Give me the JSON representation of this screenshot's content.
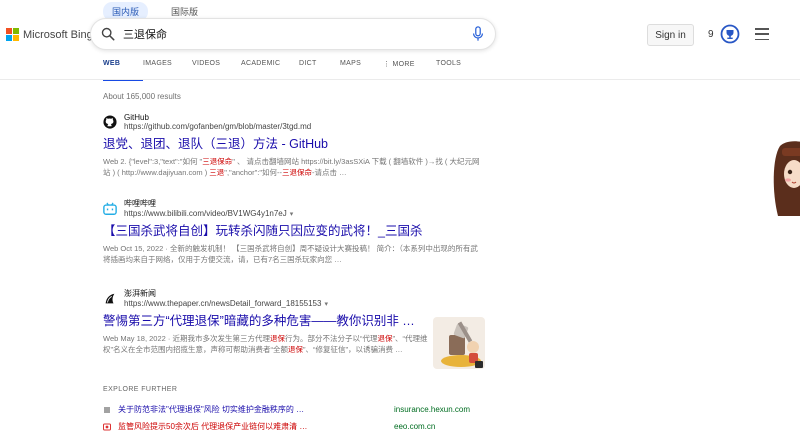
{
  "region_tabs": [
    {
      "label": "国内版",
      "active": true
    },
    {
      "label": "国际版",
      "active": false
    }
  ],
  "logo_text": "Microsoft Bing",
  "search": {
    "value": "三退保命"
  },
  "header": {
    "signin": "Sign in",
    "rewards_count": "9"
  },
  "nav_tabs": [
    {
      "label": "WEB",
      "active": true
    },
    {
      "label": "IMAGES"
    },
    {
      "label": "VIDEOS"
    },
    {
      "label": "ACADEMIC"
    },
    {
      "label": "DICT"
    },
    {
      "label": "MAPS"
    },
    {
      "label": "⋮ MORE"
    },
    {
      "label": "TOOLS"
    }
  ],
  "results_count": "About 165,000 results",
  "results": [
    {
      "site_name": "GitHub",
      "url": "https://github.com/gofanben/gm/blob/master/3tgd.md",
      "title": "退党、退团、退队（三退）方法 - GitHub",
      "snippet": [
        {
          "t": "Web 2. {\"level\":3,\"text\":\"如何 \""
        },
        {
          "t": "三退保命",
          "hl": true
        },
        {
          "t": "\" 、 请点击翻墙网站 https://bit.ly/3asSXiA 下载 ( 翻墙软件 )→找 ( 大纪元网站 ) ( http://www.dajiyuan.com ) "
        },
        {
          "t": "三退",
          "hl": true
        },
        {
          "t": "\",\"anchor\":\"如何--"
        },
        {
          "t": "三退保命",
          "hl": true
        },
        {
          "t": "-请点击 …"
        }
      ]
    },
    {
      "site_name": "哔哩哔哩",
      "url": "https://www.bilibili.com/video/BV1WG4y1n7eJ",
      "title": "【三国杀武将自创】玩转杀闪随只因应变的武将！_三国杀",
      "snippet": [
        {
          "t": "Web Oct 15, 2022 · 全新的触发机制！ 【三国杀武将自创】周不疑设计大赛投稿！ 简介：（本系列中出现的所有武将插画均来自于网络，仅用于方便交流，请，已有7名三国杀玩家向您 …"
        }
      ]
    },
    {
      "site_name": "澎湃新闻",
      "url": "https://www.thepaper.cn/newsDetail_forward_18155153",
      "title": "警惕第三方“代理退保”暗藏的多种危害——教你识别非 …",
      "snippet": [
        {
          "t": "Web May 18, 2022 · 近期我市多次发生第三方代理"
        },
        {
          "t": "退保",
          "hl": true
        },
        {
          "t": "行为。部分不法分子以“代理"
        },
        {
          "t": "退保",
          "hl": true
        },
        {
          "t": "”、“代理维权”名义在全市范围内招揽生意，声称可帮助消费者“全额"
        },
        {
          "t": "退保",
          "hl": true
        },
        {
          "t": "”、“修复征信”，以诱骗消费 …"
        }
      ]
    }
  ],
  "explore": {
    "heading": "EXPLORE FURTHER",
    "items": [
      {
        "text": "关于防范非法\"代理退保\"风险 切实维护金融秩序的 …",
        "domain": "insurance.hexun.com"
      },
      {
        "text": "监管风险提示50余次后 代理退保产业链何以难肃清 …",
        "domain": "eeo.com.cn"
      }
    ]
  },
  "colors": {
    "link": "#1a0dab",
    "highlight": "#c00000",
    "accent": "#174ae4",
    "domain": "#006d21"
  }
}
